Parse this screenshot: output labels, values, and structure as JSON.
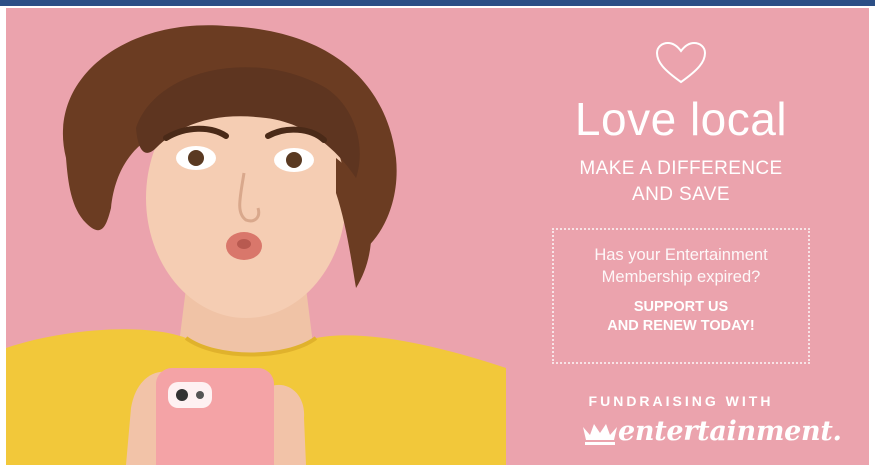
{
  "banner": {
    "headline": "Love local",
    "subhead_lines": [
      "MAKE A DIFFERENCE",
      "AND SAVE"
    ],
    "promo": {
      "question_lines": [
        "Has your Entertainment",
        "Membership expired?"
      ],
      "cta_lines": [
        "SUPPORT US",
        "AND RENEW TODAY!"
      ]
    },
    "fundraising_label": "FUNDRAISING WITH",
    "brand_name": "entertainment.",
    "icons": {
      "heart": "heart-outline-icon",
      "crown": "crown-icon"
    }
  },
  "colors": {
    "top_strip": "#2c4f86",
    "background": "#eba3ad",
    "text": "#ffffff",
    "shirt": "#f2c83a",
    "phone": "#f4a3a6"
  }
}
